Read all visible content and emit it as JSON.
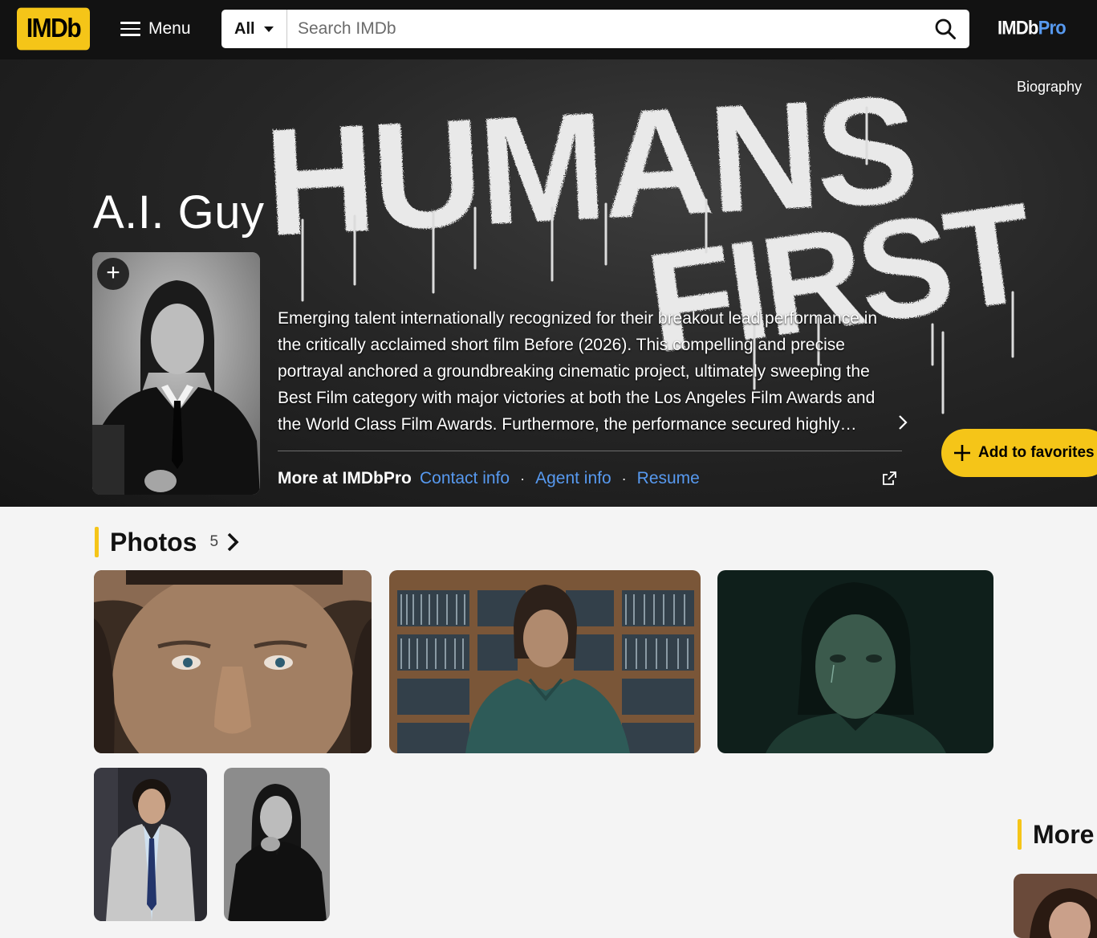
{
  "nav": {
    "logo": "IMDb",
    "menu_label": "Menu",
    "search_category": "All",
    "search_placeholder": "Search IMDb",
    "pro_logo_left": "IMDb",
    "pro_logo_right": "Pro"
  },
  "hero": {
    "biography_link": "Biography",
    "graffiti_line1": "HUMANS",
    "graffiti_line2": "FIRST",
    "name": "A.I. Guy",
    "bio": "Emerging talent internationally recognized for their breakout lead performance in the critically acclaimed short film Before (2026). This compelling and precise portrayal anchored a groundbreaking cinematic project, ultimately sweeping the Best Film category with major victories at both the Los Angeles Film Awards and the World Class Film Awards. Furthermore, the performance secured highly…",
    "more_at": "More at IMDbPro",
    "links": {
      "contact": "Contact info",
      "agent": "Agent info",
      "resume": "Resume",
      "separator": "·"
    },
    "favorite_label": "Add to favorites"
  },
  "photos": {
    "title": "Photos",
    "count": "5"
  },
  "more": {
    "title": "More"
  },
  "colors": {
    "brand_yellow": "#f5c518",
    "link_blue": "#5799ef",
    "nav_bg": "#121212"
  },
  "icons": [
    "menu-icon",
    "caret-down-icon",
    "search-icon",
    "plus-icon",
    "chevron-right-icon",
    "external-link-icon"
  ]
}
